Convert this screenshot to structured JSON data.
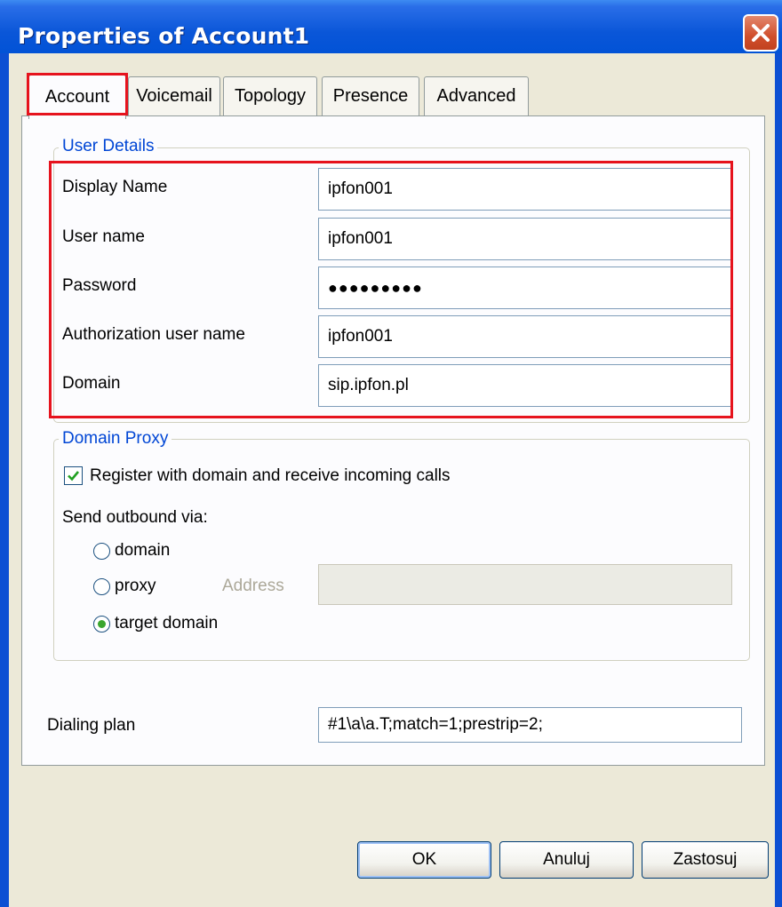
{
  "window": {
    "title": "Properties of Account1"
  },
  "tabs": [
    {
      "label": "Account",
      "active": true
    },
    {
      "label": "Voicemail",
      "active": false
    },
    {
      "label": "Topology",
      "active": false
    },
    {
      "label": "Presence",
      "active": false
    },
    {
      "label": "Advanced",
      "active": false
    }
  ],
  "user_details": {
    "legend": "User Details",
    "display_name": {
      "label": "Display Name",
      "value": "ipfon001"
    },
    "user_name": {
      "label": "User name",
      "value": "ipfon001"
    },
    "password": {
      "label": "Password",
      "value": "●●●●●●●●●"
    },
    "auth_user_name": {
      "label": "Authorization user name",
      "value": "ipfon001"
    },
    "domain": {
      "label": "Domain",
      "value": "sip.ipfon.pl"
    }
  },
  "domain_proxy": {
    "legend": "Domain Proxy",
    "register_label": "Register with domain and receive incoming calls",
    "register_checked": true,
    "send_outbound_label": "Send outbound via:",
    "options": [
      {
        "label": "domain",
        "selected": false
      },
      {
        "label": "proxy",
        "selected": false
      },
      {
        "label": "target domain",
        "selected": true
      }
    ],
    "address_label": "Address",
    "address_value": ""
  },
  "dialing_plan": {
    "label": "Dialing plan",
    "value": "#1\\a\\a.T;match=1;prestrip=2;"
  },
  "buttons": {
    "ok": "OK",
    "cancel": "Anuluj",
    "apply": "Zastosuj"
  },
  "colors": {
    "highlight": "#e6131d",
    "legend_text": "#0046d5",
    "title_bar": "#0052d6",
    "client_bg": "#ece9d8"
  },
  "icons": {
    "close": "close-x-icon",
    "check": "checkmark-icon"
  }
}
